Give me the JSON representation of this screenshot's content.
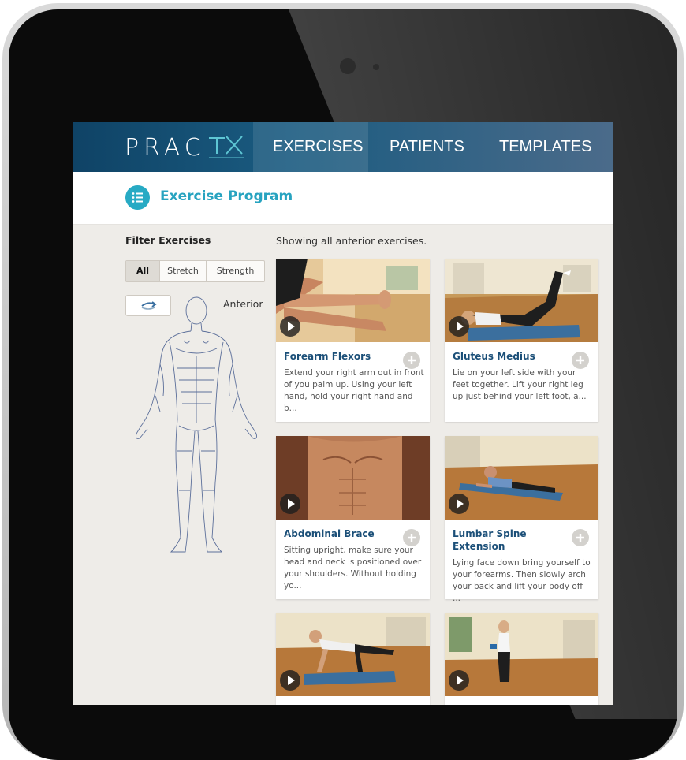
{
  "app": {
    "logo_text": "PRAC",
    "logo_mark": "TX"
  },
  "nav": {
    "items": [
      {
        "label": "EXERCISES",
        "active": true
      },
      {
        "label": "PATIENTS",
        "active": false
      },
      {
        "label": "TEMPLATES",
        "active": false
      }
    ]
  },
  "page": {
    "title": "Exercise Program",
    "title_icon": "list-icon"
  },
  "filter": {
    "label": "Filter Exercises",
    "segments": [
      "All",
      "Stretch",
      "Strength"
    ],
    "selected": "All",
    "view_label": "Anterior",
    "flip_icon": "flip-arrows-icon"
  },
  "results": {
    "summary": "Showing all anterior exercises.",
    "cards": [
      {
        "title": "Forearm Flexors",
        "desc": "Extend your right arm out in front of you palm up. Using your left hand, hold your right hand and b..."
      },
      {
        "title": "Gluteus Medius",
        "desc": "Lie on your left side with your feet together. Lift your right leg up just behind your left foot, a..."
      },
      {
        "title": "Abdominal Brace",
        "desc": "Sitting upright, make sure your head and neck is positioned over your shoulders. Without holding yo..."
      },
      {
        "title": "Lumbar Spine Extension",
        "desc": "Lying face down bring yourself to your forearms. Then slowly arch your back and lift your body off ..."
      },
      {
        "title": "",
        "desc": ""
      },
      {
        "title": "",
        "desc": ""
      }
    ]
  },
  "colors": {
    "nav_bg": "#0f4366",
    "accent": "#27a3c0",
    "card_title": "#1b4f78"
  }
}
